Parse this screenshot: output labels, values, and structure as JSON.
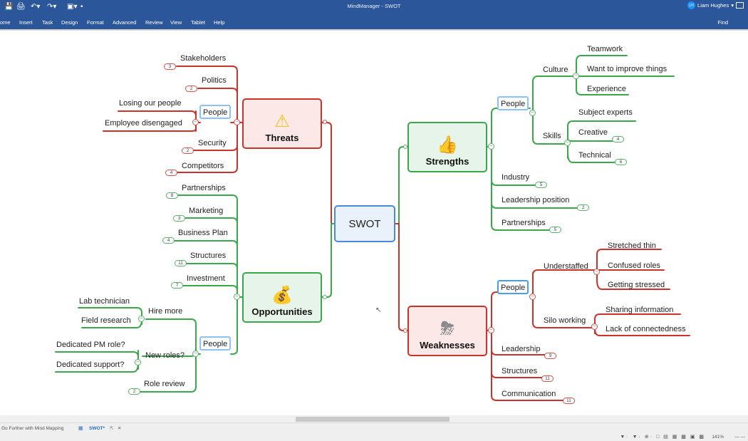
{
  "window": {
    "title": "MindManager - SWOT",
    "user_name": "Liam Hughes",
    "user_initials": "LH",
    "quick_access": [
      "save-icon",
      "print-icon",
      "undo-icon",
      "redo-icon",
      "help-icon",
      "customize-icon"
    ]
  },
  "ribbon": {
    "tabs": [
      "ome",
      "Insert",
      "Task",
      "Design",
      "Format",
      "Advanced",
      "Review",
      "View",
      "Tablet",
      "Help"
    ],
    "find_label": "Find"
  },
  "map": {
    "central": "SWOT",
    "colors": {
      "red": "#c8342c",
      "green": "#3aa84a",
      "blue": "#4a8ad6"
    },
    "threats": {
      "label": "Threats",
      "icon": "warning-icon",
      "items": [
        {
          "label": "Stakeholders",
          "badge": "3"
        },
        {
          "label": "Politics",
          "badge": "2"
        },
        {
          "label": "People",
          "children": [
            "Losing our people",
            "Employee disengaged"
          ]
        },
        {
          "label": "Security",
          "badge": "2"
        },
        {
          "label": "Competitors",
          "badge": "4"
        }
      ]
    },
    "opportunities": {
      "label": "Opportunities",
      "icon": "money-bag-icon",
      "items": [
        {
          "label": "Partnerships",
          "badge": "8"
        },
        {
          "label": "Marketing",
          "badge": "3"
        },
        {
          "label": "Business Plan",
          "badge": "4"
        },
        {
          "label": "Structures",
          "badge": "11"
        },
        {
          "label": "Investment",
          "badge": "7"
        },
        {
          "label": "People",
          "children": [
            {
              "label": "Hire more",
              "children": [
                "Lab technician",
                "Field research"
              ]
            },
            {
              "label": "New roles?",
              "children": [
                "Dedicated PM role?",
                "Dedicated support?"
              ]
            },
            {
              "label": "Role review",
              "badge": "2"
            }
          ]
        }
      ]
    },
    "strengths": {
      "label": "Strengths",
      "icon": "thumbs-up-icon",
      "items": [
        {
          "label": "People",
          "children": [
            {
              "label": "Culture",
              "children": [
                "Teamwork",
                "Want to improve things",
                "Experience"
              ]
            },
            {
              "label": "Skills",
              "children": [
                {
                  "label": "Subject experts"
                },
                {
                  "label": "Creative",
                  "badge": "4"
                },
                {
                  "label": "Technical",
                  "badge": "6"
                }
              ]
            }
          ]
        },
        {
          "label": "Industry",
          "badge": "5"
        },
        {
          "label": "Leadership position",
          "badge": "2"
        },
        {
          "label": "Partnerships",
          "badge": "5"
        }
      ]
    },
    "weaknesses": {
      "label": "Weaknesses",
      "icon": "storm-cloud-icon",
      "items": [
        {
          "label": "People",
          "children": [
            {
              "label": "Understaffed",
              "children": [
                "Stretched thin",
                "Confused roles",
                "Getting stressed"
              ]
            },
            {
              "label": "Silo working",
              "children": [
                "Sharing information",
                "Lack of connectedness"
              ]
            }
          ]
        },
        {
          "label": "Leadership",
          "badge": "9"
        },
        {
          "label": "Structures",
          "badge": "11"
        },
        {
          "label": "Communication",
          "badge": "11"
        }
      ]
    }
  },
  "tabs": {
    "items": [
      {
        "label": "Go Further with Mind Mapping",
        "active": false
      },
      {
        "label": "SWOT*",
        "active": true
      }
    ]
  },
  "status": {
    "zoom": "141%"
  }
}
